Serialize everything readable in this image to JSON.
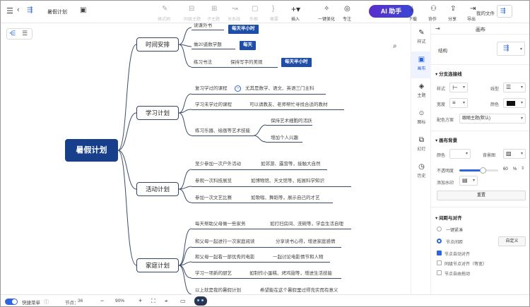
{
  "app": {
    "title": "暑假计划"
  },
  "toolbar": {
    "style_brush": "格式刷",
    "sibling_topic": "同级主题",
    "child_topic": "子主题",
    "relation": "关系线",
    "frame": "外框",
    "summary": "概要",
    "insert": "插入",
    "beautify": "一键美化",
    "focus": "专注",
    "ai": "AI 助手",
    "download": "下载",
    "collab": "协作",
    "share": "分享",
    "export": "导出",
    "my_files": "我的文件"
  },
  "mindmap": {
    "root": "暑假计划",
    "time": {
      "label": "时间安排",
      "c1": "读课外书",
      "c1_tag": "每天半小时",
      "c2": "做20道数学题",
      "c2_tag": "每天",
      "c3": "练习书法",
      "c3_sub": "保持写字的美观",
      "c3_tag": "每天半小时"
    },
    "study": {
      "label": "学习计划",
      "c1": "复习学过的课程",
      "c1_sub": "尤其是数学、语文、英语三门主科",
      "c2": "学习未学过的课程",
      "c2_sub": "可以请教友、老师帮忙寻找合适的教材",
      "c3": "练习乐器、绘画等艺术技能",
      "c3_sub1": "保持艺术细胞的活跃",
      "c3_sub2": "增加个人兴趣"
    },
    "activity": {
      "label": "活动计划",
      "c1": "至少参加一次户外活动",
      "c1_sub": "如郊游、露营等，接触大自然",
      "c2": "参观一次科技展览",
      "c2_sub": "如博物馆、天文馆等，拓展科学知识",
      "c3": "参加一次文艺比赛",
      "c3_sub": "如歌唱、舞蹈等，展示自己的才艺"
    },
    "family": {
      "label": "家庭计划",
      "c1": "每天帮助父母做一些家务",
      "c1_sub": "如打扫房间、洗碗等，学会生活自理",
      "c2": "和父母一起进行一次家庭阅读",
      "c2_sub": "分享读书心得，增进家庭感情",
      "c3": "和父母一起看一部优秀的电影",
      "c3_sub": "一起讨论电影情节和人物",
      "c4": "学习一项新的厨艺",
      "c4_sub": "如制作小蛋糕、烤鸡翅等，增进生活技能",
      "c5": "以上就是我的暑假计划",
      "c5_sub": "希望能在这个暑假里过得充实而有意义"
    }
  },
  "side_tabs": [
    {
      "label": "样式"
    },
    {
      "label": "画布"
    },
    {
      "label": "主题"
    },
    {
      "label": "图标"
    },
    {
      "label": "幻灯"
    },
    {
      "label": "历史"
    }
  ],
  "panel": {
    "title": "画布",
    "structure_label": "结构",
    "branch_section": "分支连接线",
    "style_label": "样式",
    "line_type_label": "线型",
    "width_label": "宽度",
    "color_label": "颜色",
    "color_scheme_label": "配色方案",
    "color_scheme_value": "跟随主题(默认)",
    "bg_section": "画布背景",
    "bg_color_label": "颜色",
    "bg_image_label": "背景图",
    "opacity_label": "不透明度",
    "opacity_value": "60",
    "opacity_unit": "%",
    "opacity": 0.6,
    "watermark_label": "添加水印",
    "reset_btn": "重置",
    "spacing_section": "间距与对齐",
    "opt_compact": "一键紧凑",
    "opt_spacing": "节点间距",
    "custom_btn": "自定义",
    "chk_auto_align": "节点自动对齐",
    "chk_same_level": "同级节点对齐（等宽）",
    "chk_free_drag": "节点自由拖动",
    "branch_color": "#111111"
  },
  "bottombar": {
    "quick_menu": "快捷菜单",
    "nodes_label": "节点：",
    "nodes_count": "36",
    "zoom": "90%"
  }
}
